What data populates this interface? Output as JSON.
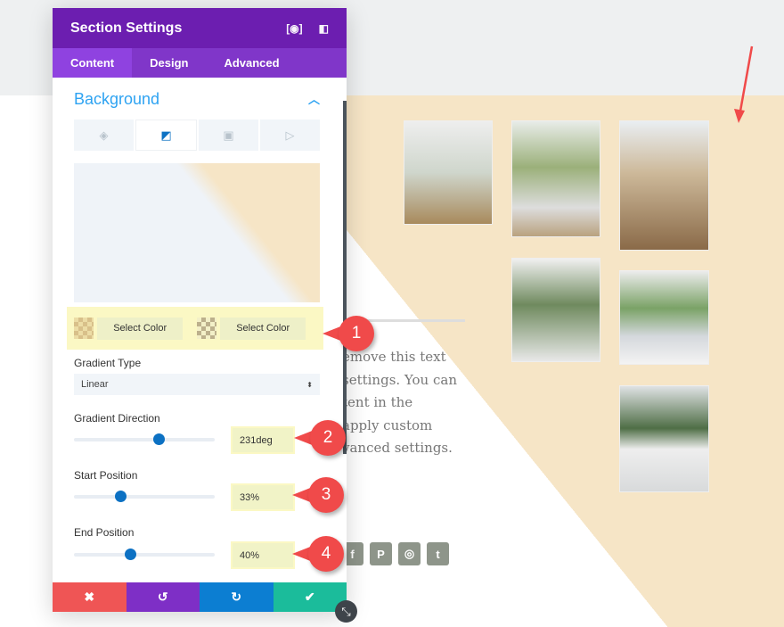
{
  "panel": {
    "title": "Section Settings",
    "tabs": [
      "Content",
      "Design",
      "Advanced"
    ],
    "active_tab": "Content",
    "section_title": "Background",
    "bg_tabs": [
      "paint-bucket-icon",
      "gradient-icon",
      "image-icon",
      "video-icon"
    ],
    "color_buttons": [
      "Select Color",
      "Select Color"
    ],
    "gradient_type_label": "Gradient Type",
    "gradient_type": "Linear",
    "direction_label": "Gradient Direction",
    "direction": "231deg",
    "direction_pct": 60,
    "start_label": "Start Position",
    "start": "33%",
    "start_pct": 33,
    "end_label": "End Position",
    "end": "40%",
    "end_pct": 40
  },
  "colors": {
    "accent": "#6c1eb0",
    "beige": "#f6e5c6",
    "annotation": "#f04a4a"
  },
  "annotations": [
    "1",
    "2",
    "3",
    "4"
  ],
  "page": {
    "text_lines": [
      "emove this text",
      "settings. You can",
      "tent in the",
      "apply custom",
      "vanced settings."
    ],
    "social": [
      "f",
      "P",
      "◎",
      "t"
    ]
  }
}
